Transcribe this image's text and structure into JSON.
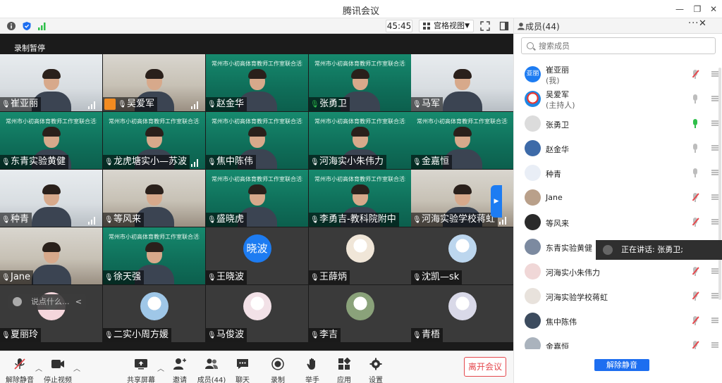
{
  "window": {
    "title": "腾讯会议"
  },
  "toolbar": {
    "timer": "45:45",
    "view_label": "宫格视图"
  },
  "video": {
    "record_status": "录制暂停",
    "chat_placeholder": "说点什么..."
  },
  "tiles": [
    "崔亚丽",
    "吴爱军",
    "赵金华",
    "张勇卫",
    "马军",
    "东青实验黄健",
    "龙虎塘实小—苏波",
    "焦中陈伟",
    "河海实小朱伟力",
    "金嘉恒",
    "种青",
    "等风来",
    "盛晓虎",
    "李勇吉-教科院附中",
    "河海实验学校蒋虹",
    "Jane",
    "徐天强",
    "王晓波",
    "王薛炳",
    "沈凯—sk",
    "夏丽玲",
    "二实小周方媛",
    "马俊波",
    "李吉",
    "青梧"
  ],
  "tile_banner": "常州市小初高体育教师工作室联合活动",
  "avatar_text_wxb": "晓波",
  "bottombar": {
    "unmute": "解除静音",
    "stop_video": "停止视频",
    "share": "共享屏幕",
    "invite": "邀请",
    "members": "成员(44)",
    "chat": "聊天",
    "record": "录制",
    "raise_hand": "举手",
    "apps": "应用",
    "settings": "设置",
    "leave": "离开会议"
  },
  "panel": {
    "title": "成员(44)",
    "search_placeholder": "搜索成员",
    "members": [
      {
        "name": "崔亚丽",
        "sub": "(我)",
        "avatar": "亚丽",
        "mic": "muted"
      },
      {
        "name": "吴爱军",
        "sub": "(主持人)",
        "mic": "off"
      },
      {
        "name": "张勇卫",
        "sub": "",
        "mic": "active"
      },
      {
        "name": "赵金华",
        "sub": "",
        "mic": "off"
      },
      {
        "name": "种青",
        "sub": "",
        "mic": "off"
      },
      {
        "name": "Jane",
        "sub": "",
        "mic": "muted"
      },
      {
        "name": "等风来",
        "sub": "",
        "mic": "muted"
      },
      {
        "name": "东青实验黄健",
        "sub": "",
        "mic": "muted"
      },
      {
        "name": "河海实小朱伟力",
        "sub": "",
        "mic": "muted"
      },
      {
        "name": "河海实验学校蒋虹",
        "sub": "",
        "mic": "muted"
      },
      {
        "name": "焦中陈伟",
        "sub": "",
        "mic": "muted"
      },
      {
        "name": "金嘉恒",
        "sub": "",
        "mic": "muted"
      }
    ],
    "speaking": "正在讲话: 张勇卫;",
    "unmute_all": "解除静音"
  },
  "colors": {
    "accent": "#1d6ef0",
    "danger": "#e5484d",
    "tile_green": "#168a6e",
    "active_mic": "#2fbf4a"
  }
}
